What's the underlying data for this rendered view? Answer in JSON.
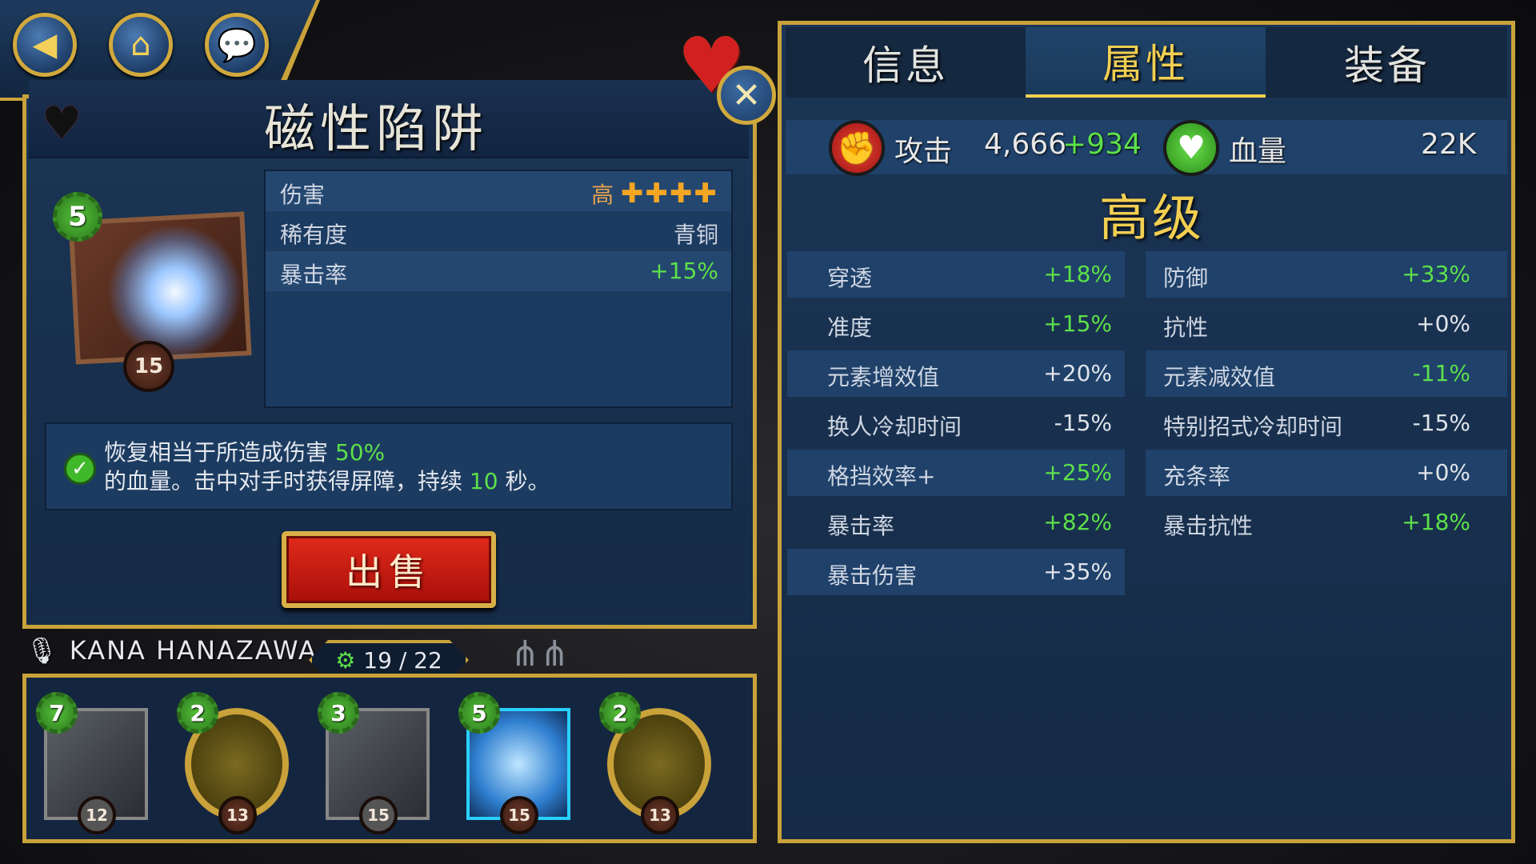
{
  "nav": {
    "back_icon": "back-arrow-icon",
    "home_icon": "home-icon",
    "chat_icon": "chat-bubble-icon"
  },
  "item": {
    "title": "磁性陷阱",
    "gear_level": "5",
    "card_level": "15",
    "stats": [
      {
        "label": "伤害",
        "value": "高",
        "pips": "✚✚✚✚"
      },
      {
        "label": "稀有度",
        "value": "青铜"
      },
      {
        "label": "暴击率",
        "value": "+15%"
      }
    ],
    "desc_line1_a": "恢复相当于所造成伤害",
    "desc_line1_b": "50%",
    "desc_line2_a": "的血量。击中对手时获得屏障，持续",
    "desc_line2_b": "10",
    "desc_line2_c": "秒。",
    "sell_label": "出售"
  },
  "voice_actor": "KANA  HANAZAWA",
  "counter": "19 / 22",
  "roster": [
    {
      "gear": "7",
      "level": "12"
    },
    {
      "gear": "2",
      "level": "13"
    },
    {
      "gear": "3",
      "level": "15"
    },
    {
      "gear": "5",
      "level": "15"
    },
    {
      "gear": "2",
      "level": "13"
    }
  ],
  "tabs": {
    "info": "信息",
    "attributes": "属性",
    "equipment": "装备"
  },
  "summary": {
    "attack_label": "攻击",
    "attack_value": "4,666",
    "attack_bonus": "+934",
    "health_label": "血量",
    "health_value": "22K"
  },
  "tier_title": "高级",
  "attributes_left": [
    {
      "label": "穿透",
      "value": "+18%"
    },
    {
      "label": "准度",
      "value": "+15%"
    },
    {
      "label": "元素增效值",
      "value": "+20%"
    },
    {
      "label": "换人冷却时间",
      "value": "-15%"
    },
    {
      "label": "格挡效率+",
      "value": "+25%"
    },
    {
      "label": "暴击率",
      "value": "+82%"
    },
    {
      "label": "暴击伤害",
      "value": "+35%"
    }
  ],
  "attributes_right": [
    {
      "label": "防御",
      "value": "+33%"
    },
    {
      "label": "抗性",
      "value": "+0%"
    },
    {
      "label": "元素减效值",
      "value": "-11%"
    },
    {
      "label": "特别招式冷却时间",
      "value": "-15%"
    },
    {
      "label": "充条率",
      "value": "+0%"
    },
    {
      "label": "暴击抗性",
      "value": "+18%"
    }
  ],
  "colors": {
    "gold": "#c9a23a",
    "green": "#5de04a",
    "panel": "#1b3555",
    "sell_red": "#d8221a"
  }
}
